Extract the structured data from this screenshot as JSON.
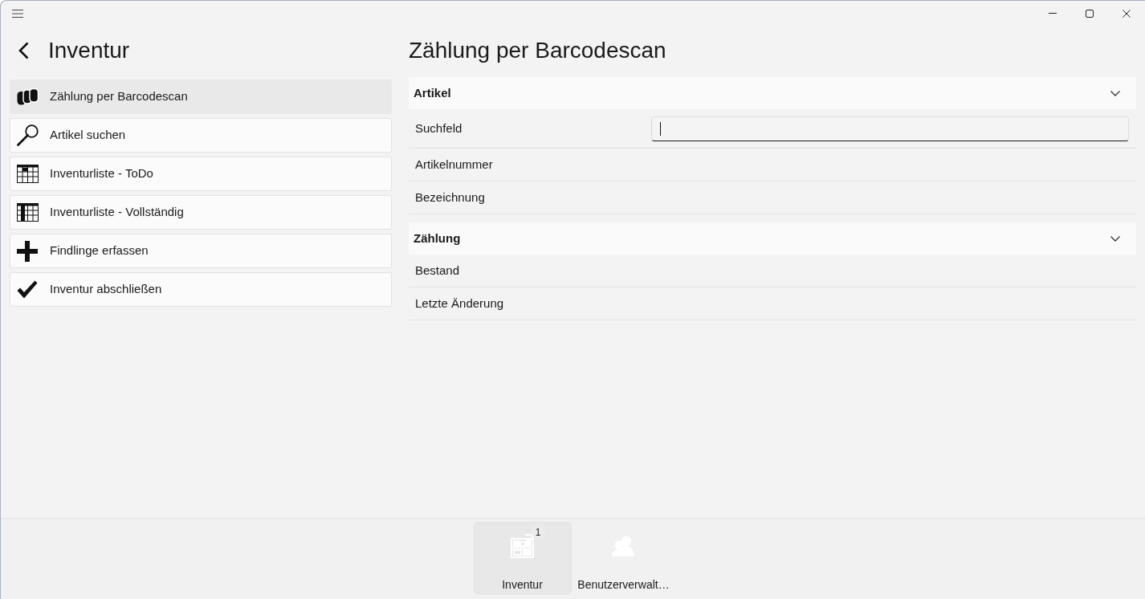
{
  "nav_pane": {
    "title": "Inventur",
    "items": [
      {
        "label": "Zählung per Barcodescan",
        "selected": true
      },
      {
        "label": "Artikel suchen",
        "selected": false
      },
      {
        "label": "Inventurliste - ToDo",
        "selected": false
      },
      {
        "label": "Inventurliste - Vollständig",
        "selected": false
      },
      {
        "label": "Findlinge erfassen",
        "selected": false
      },
      {
        "label": "Inventur abschließen",
        "selected": false
      }
    ]
  },
  "detail": {
    "title": "Zählung per Barcodescan",
    "sections": [
      {
        "title": "Artikel",
        "expanded": true,
        "fields": [
          {
            "label": "Suchfeld",
            "kind": "input",
            "focused": true
          },
          {
            "label": "Artikelnummer",
            "kind": "text"
          },
          {
            "label": "Bezeichnung",
            "kind": "text"
          }
        ]
      },
      {
        "title": "Zählung",
        "expanded": true,
        "fields": [
          {
            "label": "Bestand",
            "kind": "text"
          },
          {
            "label": "Letzte Änderung",
            "kind": "text"
          }
        ]
      }
    ]
  },
  "bottom_nav": [
    {
      "label": "Inventur",
      "selected": true,
      "badge": "1"
    },
    {
      "label": "Benutzerverwalt…",
      "selected": false
    }
  ]
}
